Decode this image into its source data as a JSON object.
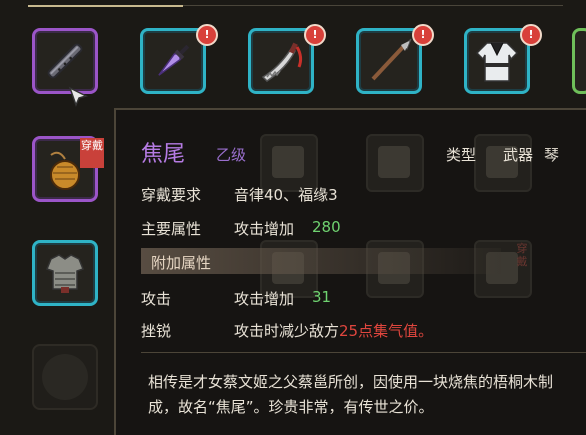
{
  "inventory": {
    "slots": [
      {
        "name": "flute-icon",
        "rarity": "purple",
        "alert": false
      },
      {
        "name": "purple-sword-icon",
        "rarity": "cyan",
        "alert": true
      },
      {
        "name": "saber-icon",
        "rarity": "cyan",
        "alert": true
      },
      {
        "name": "spear-icon",
        "rarity": "cyan",
        "alert": true
      },
      {
        "name": "robe-icon",
        "rarity": "cyan",
        "alert": true
      }
    ],
    "alert_symbol": "!",
    "equipped_badge": "穿戴",
    "ghost_badge": "穿戴"
  },
  "tooltip": {
    "item_name": "焦尾",
    "grade": "乙级",
    "type_label": "类型",
    "type_value": "武器",
    "subtype": "琴",
    "requirement_label": "穿戴要求",
    "requirement_value": "音律40、福缘3",
    "main_attr_label": "主要属性",
    "main_attr_text": "攻击增加",
    "main_attr_value": "280",
    "extra_attr_header": "附加属性",
    "extra_rows": [
      {
        "label": "攻击",
        "text": "攻击增加",
        "value": "31"
      },
      {
        "label": "挫锐",
        "text": "攻击时减少敌方",
        "value": "25点集气值",
        "suffix": "。"
      }
    ],
    "description": "相传是才女蔡文姬之父蔡邕所创，因使用一块烧焦的梧桐木制成，故名“焦尾”。珍贵非常，有传世之价。"
  },
  "colors": {
    "purple_rarity": "#9b55c8",
    "cyan_rarity": "#2fb3c6",
    "item_name": "#b57be3",
    "stat_value_green": "#6fd270",
    "highlight_red": "#e0463e",
    "alert_red": "#d8403a"
  }
}
